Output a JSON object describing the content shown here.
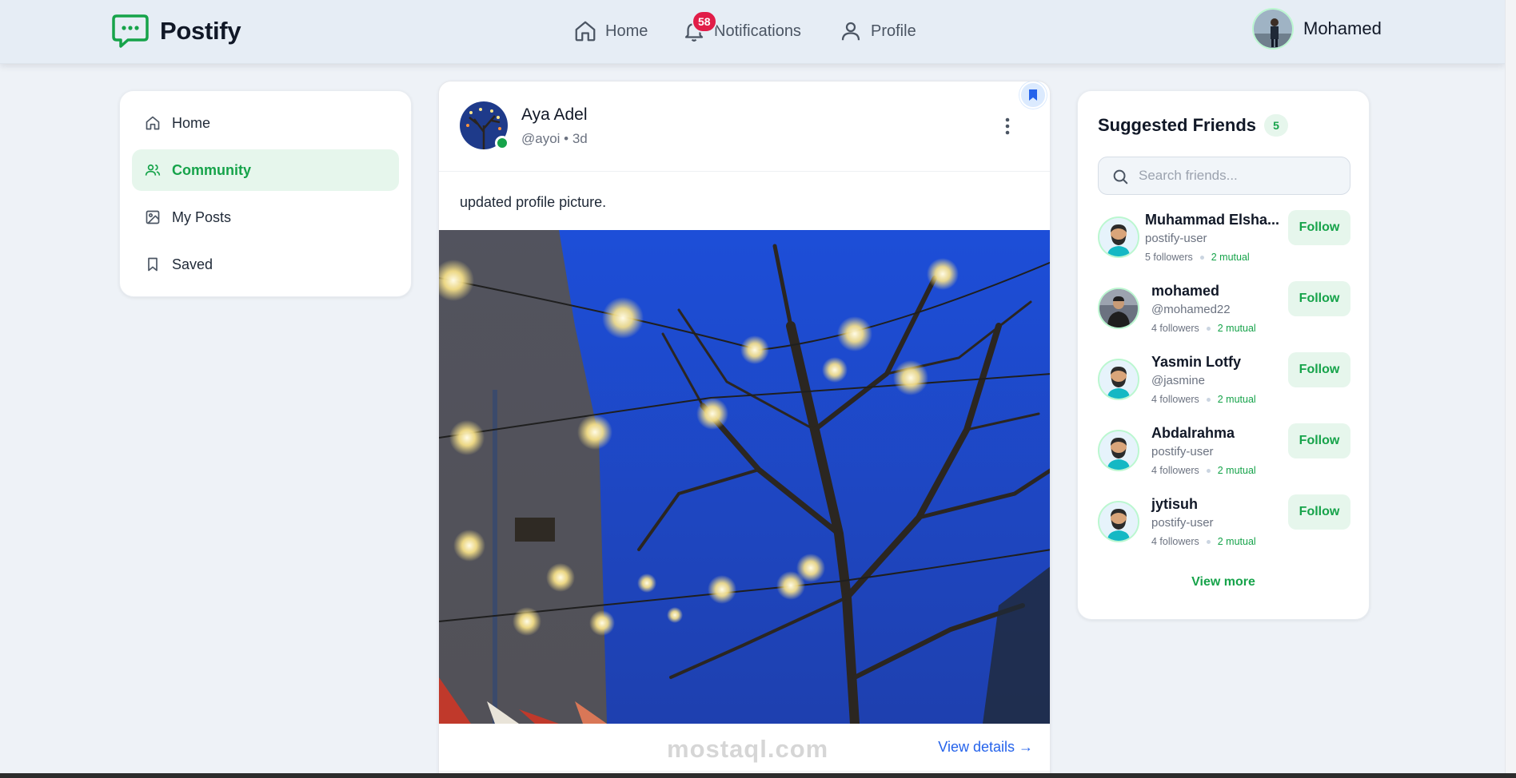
{
  "brand": {
    "name": "Postify",
    "accent": "#16a34a",
    "logo_icon": "chat-bubble-icon"
  },
  "topnav": {
    "home_label": "Home",
    "notifications_label": "Notifications",
    "notifications_count": "58",
    "profile_label": "Profile"
  },
  "user": {
    "name": "Mohamed"
  },
  "sidebar": {
    "items": [
      {
        "label": "Home",
        "icon": "home-icon",
        "active": false
      },
      {
        "label": "Community",
        "icon": "users-icon",
        "active": true
      },
      {
        "label": "My Posts",
        "icon": "image-icon",
        "active": false
      },
      {
        "label": "Saved",
        "icon": "bookmark-icon",
        "active": false
      }
    ]
  },
  "post": {
    "author_name": "Aya Adel",
    "meta": "@ayoi • 3d",
    "text": "updated profile picture.",
    "view_details": "View details →",
    "watermark": "mostaql.com"
  },
  "friends": {
    "title": "Suggested Friends",
    "count": "5",
    "search_placeholder": "Search friends...",
    "follow_label": "Follow",
    "view_more": "View more",
    "list": [
      {
        "name": "Muhammad Elsha...",
        "handle": "postify-user",
        "followers": "5 followers",
        "mutual": "2 mutual"
      },
      {
        "name": "mohamed",
        "handle": "@mohamed22",
        "followers": "4 followers",
        "mutual": "2 mutual"
      },
      {
        "name": "Yasmin Lotfy",
        "handle": "@jasmine",
        "followers": "4 followers",
        "mutual": "2 mutual"
      },
      {
        "name": "Abdalrahma",
        "handle": "postify-user",
        "followers": "4 followers",
        "mutual": "2 mutual"
      },
      {
        "name": "jytisuh",
        "handle": "postify-user",
        "followers": "4 followers",
        "mutual": "2 mutual"
      }
    ]
  }
}
